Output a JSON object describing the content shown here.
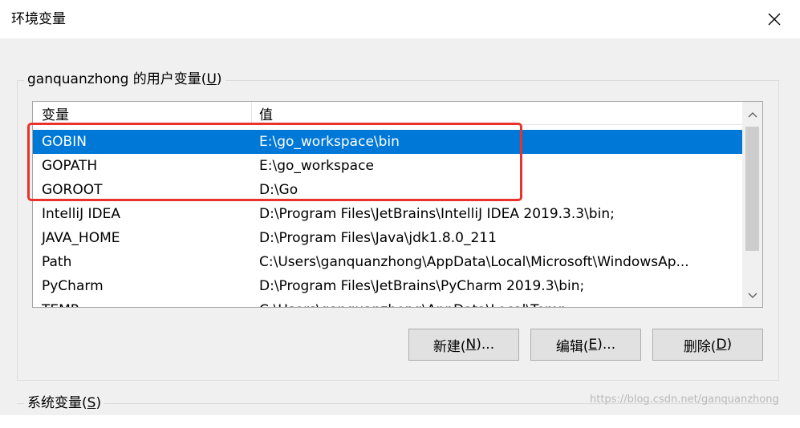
{
  "window": {
    "title": "环境变量"
  },
  "user_vars": {
    "group_label": "ganquanzhong 的用户变量(U)",
    "group_label_prefix": "ganquanzhong 的用户变量(",
    "group_label_key": "U",
    "group_label_suffix": ")",
    "columns": [
      "变量",
      "值"
    ],
    "rows": [
      {
        "name": "GOBIN",
        "value": "E:\\go_workspace\\bin",
        "selected": true
      },
      {
        "name": "GOPATH",
        "value": "E:\\go_workspace"
      },
      {
        "name": "GOROOT",
        "value": "D:\\Go"
      },
      {
        "name": "IntelliJ IDEA",
        "value": "D:\\Program Files\\JetBrains\\IntelliJ IDEA 2019.3.3\\bin;"
      },
      {
        "name": "JAVA_HOME",
        "value": "D:\\Program Files\\Java\\jdk1.8.0_211"
      },
      {
        "name": "Path",
        "value": "C:\\Users\\ganquanzhong\\AppData\\Local\\Microsoft\\WindowsAp..."
      },
      {
        "name": "PyCharm",
        "value": "D:\\Program Files\\JetBrains\\PyCharm 2019.3\\bin;"
      },
      {
        "name": "TEMP",
        "value": "C:\\Users\\ganquanzhong\\AppData\\Local\\Temp"
      }
    ],
    "buttons": {
      "new": {
        "prefix": "新建(",
        "key": "N",
        "suffix": ")..."
      },
      "edit": {
        "prefix": "编辑(",
        "key": "E",
        "suffix": ")..."
      },
      "delete": {
        "prefix": "删除(",
        "key": "D",
        "suffix": ")"
      }
    }
  },
  "system_vars": {
    "group_label_prefix": "系统变量(",
    "group_label_key": "S",
    "group_label_suffix": ")"
  },
  "watermark": "https://blog.csdn.net/ganquanzhong",
  "colors": {
    "selection": "#0078d7",
    "highlight_box": "#e8322c",
    "dialog_bg": "#f0f0f0"
  }
}
